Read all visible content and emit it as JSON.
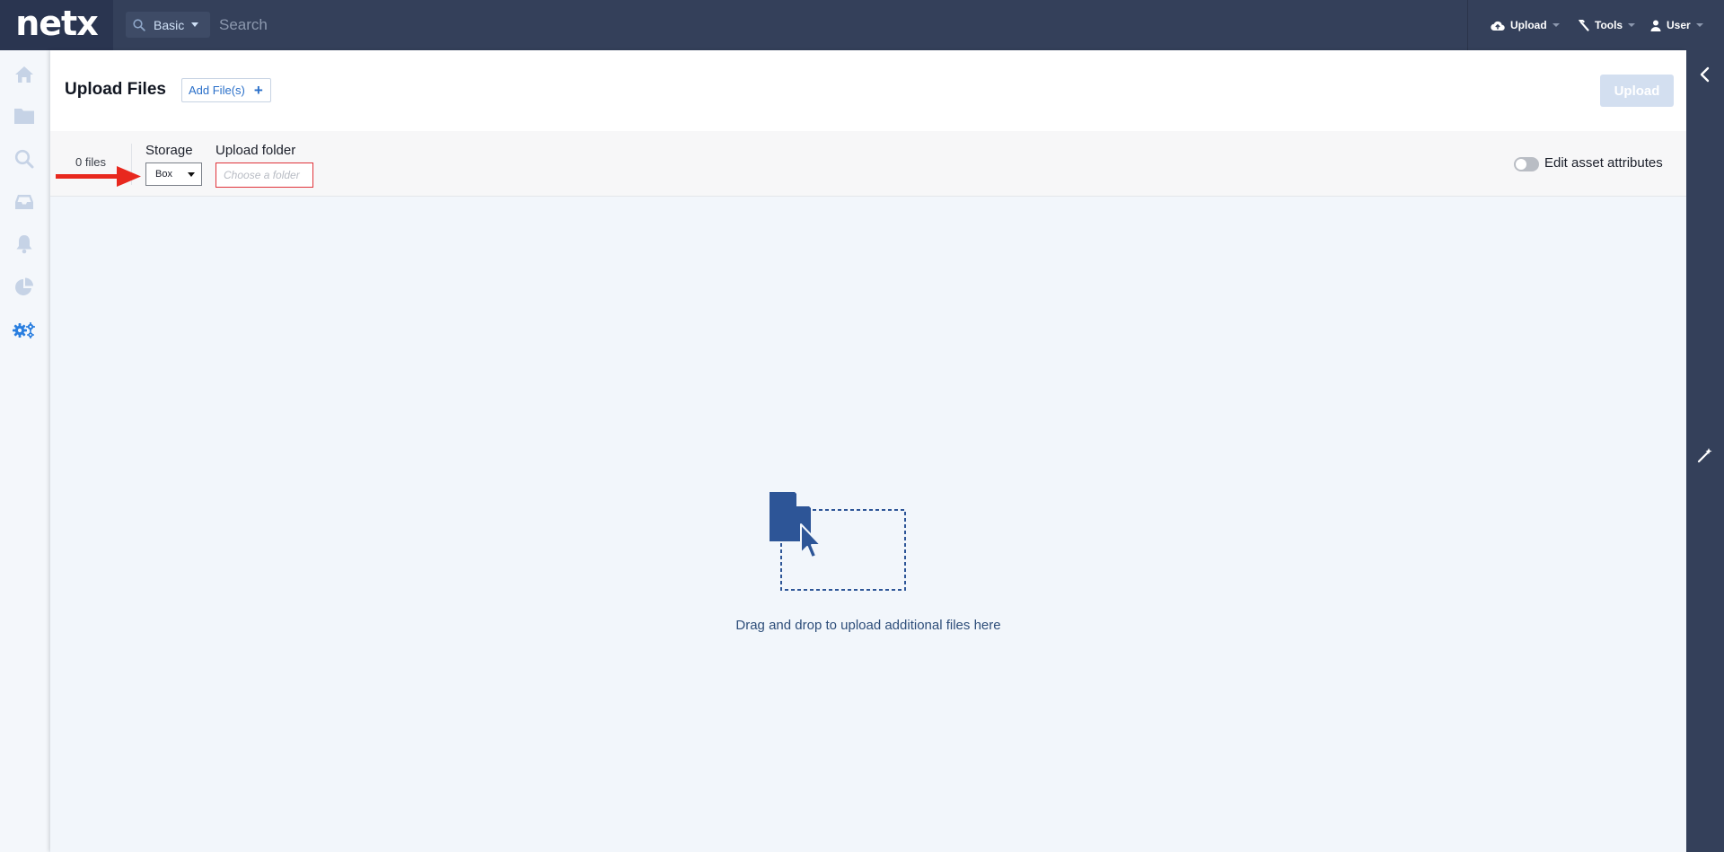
{
  "app": {
    "logo_text": "netx"
  },
  "topbar": {
    "search_mode": "Basic",
    "search_placeholder": "Search",
    "menus": [
      {
        "label": "Upload",
        "icon": "cloud-upload-icon"
      },
      {
        "label": "Tools",
        "icon": "hammer-icon"
      },
      {
        "label": "User",
        "icon": "user-icon"
      }
    ]
  },
  "sidebar": {
    "items": [
      {
        "name": "home",
        "icon": "home-icon"
      },
      {
        "name": "folders",
        "icon": "folder-icon"
      },
      {
        "name": "search",
        "icon": "search-icon"
      },
      {
        "name": "inbox",
        "icon": "inbox-icon"
      },
      {
        "name": "notifications",
        "icon": "bell-icon"
      },
      {
        "name": "reports",
        "icon": "pie-chart-icon"
      },
      {
        "name": "system",
        "icon": "gears-icon",
        "active": true
      }
    ]
  },
  "header": {
    "title": "Upload Files",
    "add_files_label": "Add File(s)",
    "add_files_icon": "+",
    "upload_label": "Upload"
  },
  "toolbar": {
    "file_count": "0 files",
    "storage_label": "Storage",
    "storage_value": "Box",
    "folder_label": "Upload folder",
    "folder_placeholder": "Choose a folder",
    "edit_attributes_label": "Edit asset attributes"
  },
  "dropzone": {
    "text": "Drag and drop to upload additional files here"
  },
  "colors": {
    "topbar": "#34405a",
    "accent": "#2a6fc9",
    "active_icon": "#2a7fe0",
    "error_border": "#e0333a",
    "annotation_arrow": "#e8281e"
  }
}
